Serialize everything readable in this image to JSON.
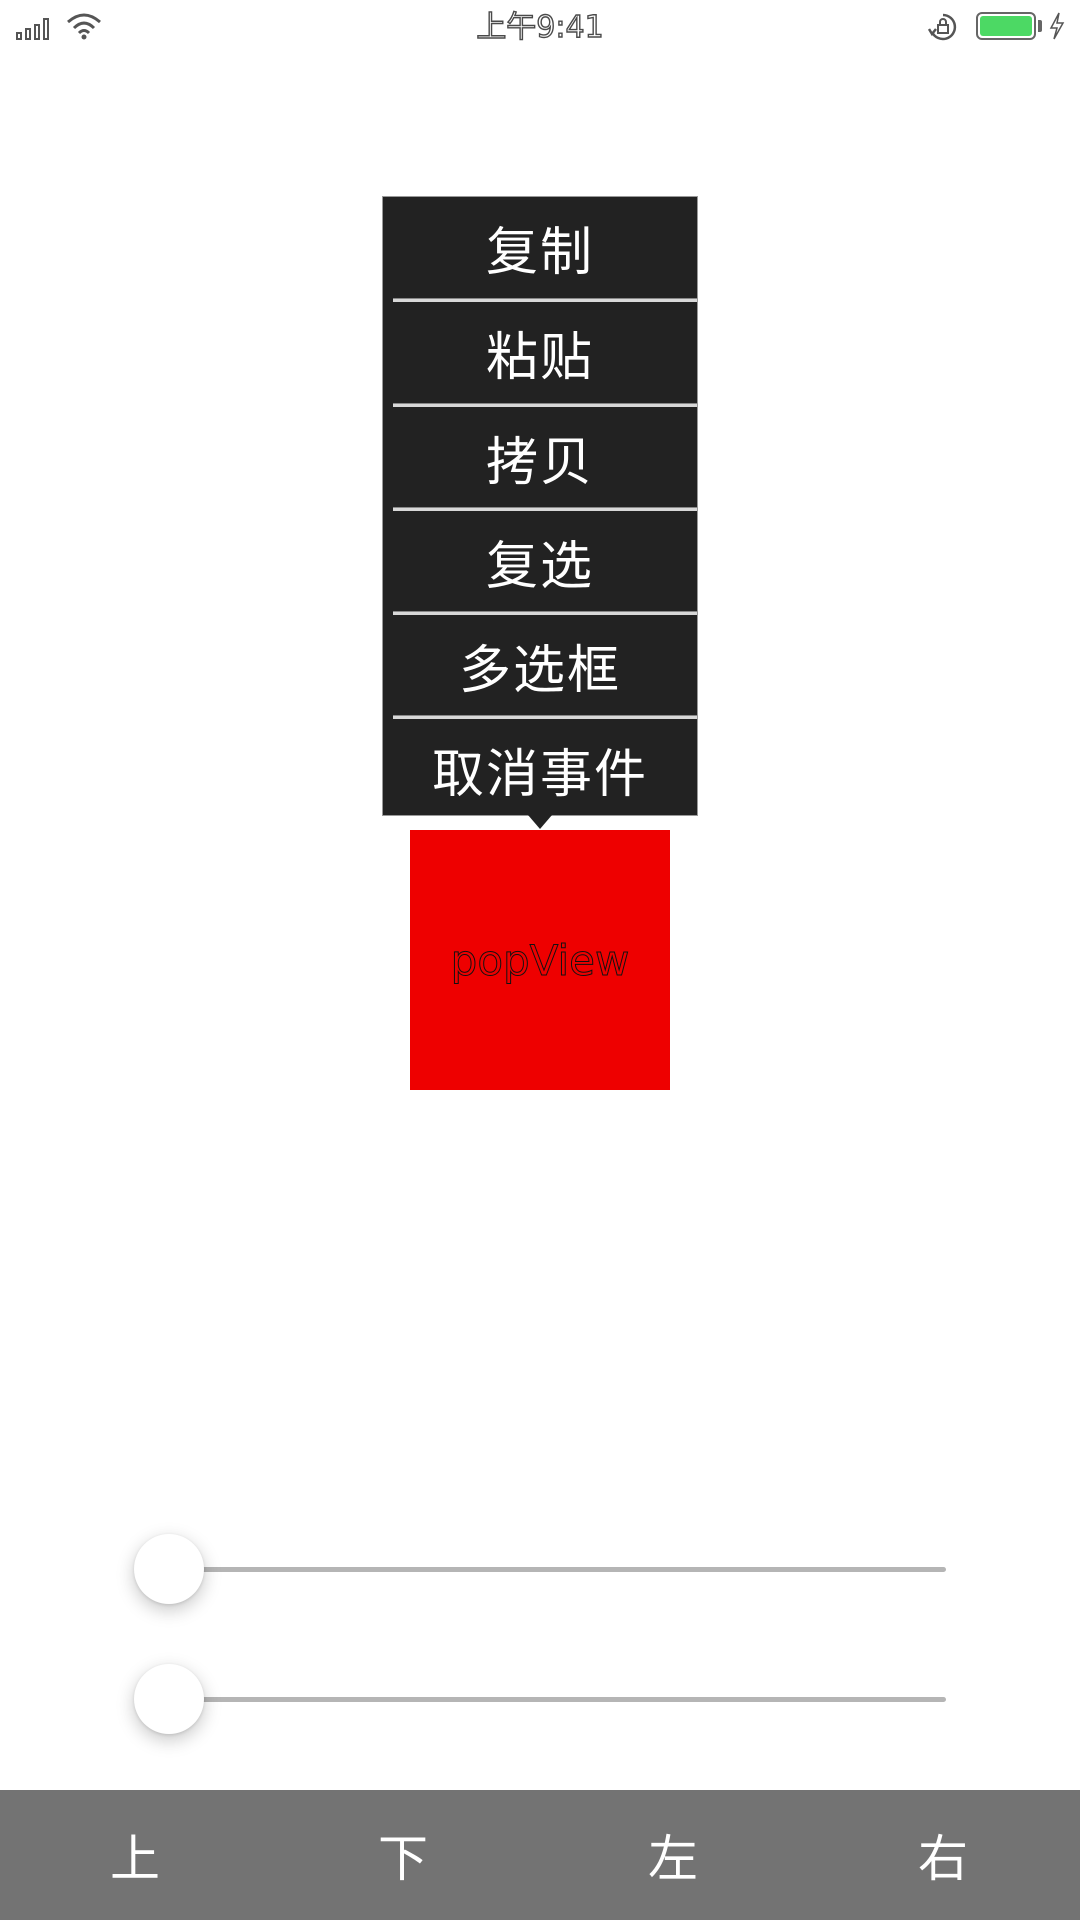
{
  "status_bar": {
    "time": "上午9:41",
    "signal_icon": "cellular-signal-icon",
    "wifi_icon": "wifi-icon",
    "rotation_lock_icon": "rotation-lock-icon",
    "battery_icon": "battery-icon",
    "battery_level": 1.0,
    "battery_color": "#4cd964",
    "charging_icon": "charging-bolt-icon"
  },
  "popup_menu": {
    "background_color": "#222222",
    "items": [
      {
        "label": "复制"
      },
      {
        "label": "粘贴"
      },
      {
        "label": "拷贝"
      },
      {
        "label": "复选"
      },
      {
        "label": "多选框"
      },
      {
        "label": "取消事件"
      }
    ]
  },
  "pop_view": {
    "label": "popView",
    "color": "#ee0000"
  },
  "sliders": [
    {
      "value": 0.0
    },
    {
      "value": 0.0
    }
  ],
  "toolbar": {
    "background_color": "#737373",
    "buttons": [
      {
        "label": "上"
      },
      {
        "label": "下"
      },
      {
        "label": "左"
      },
      {
        "label": "右"
      }
    ]
  }
}
